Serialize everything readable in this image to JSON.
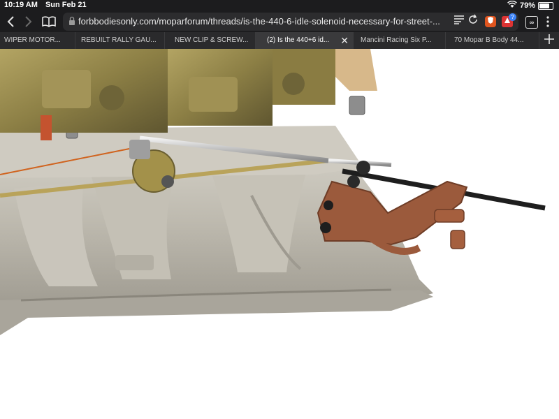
{
  "status": {
    "time": "10:19 AM",
    "date": "Sun Feb 21",
    "battery": "79%"
  },
  "browser": {
    "url": "forbbodiesonly.com/moparforum/threads/is-the-440-6-idle-solenoid-necessary-for-street-...",
    "extension_badge": "?",
    "tabs_label": "∞"
  },
  "tabs": [
    {
      "label": "WIPER MOTOR..."
    },
    {
      "label": "REBUILT RALLY GAU..."
    },
    {
      "label": "NEW CLIP & SCREW..."
    },
    {
      "label": "(2) Is the 440+6 id..."
    },
    {
      "label": "Mancini Racing Six P..."
    },
    {
      "label": "70 Mopar B Body 44..."
    }
  ],
  "colors": {
    "chrome": "#1c1c1e",
    "tabbar": "#2a2a2c",
    "active_tab": "#3a3a3c",
    "bracket": "#9b5a3c"
  }
}
